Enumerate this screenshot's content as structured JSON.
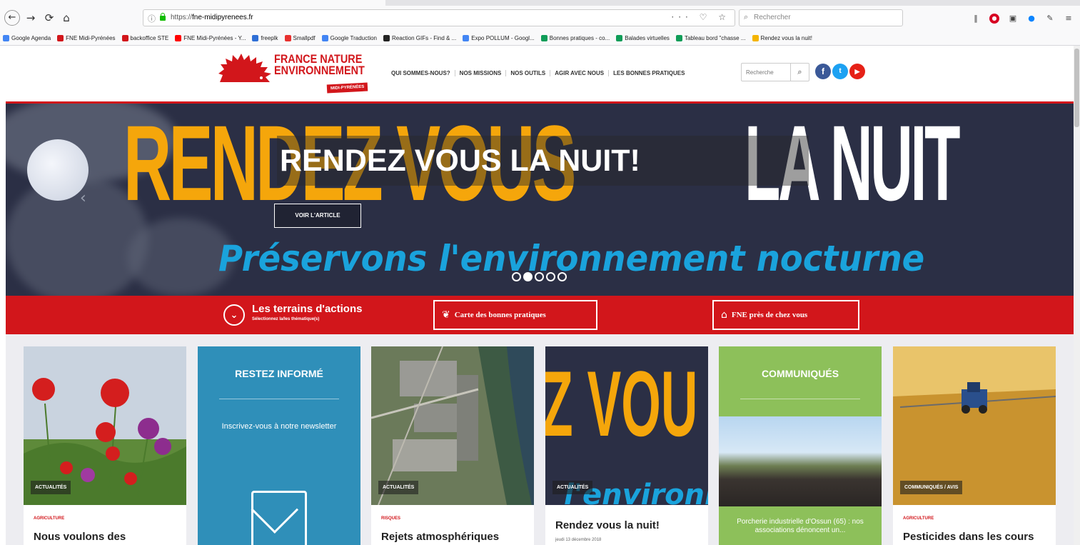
{
  "browser": {
    "back_glyph": "←",
    "forward_glyph": "→",
    "reload_glyph": "⟳",
    "home_glyph": "⌂",
    "url_prefix": "https://",
    "url_host": "fne-midipyrenees.fr",
    "url_actions": "··· ♡ ☆",
    "search_placeholder": "Rechercher",
    "bookmarks": [
      {
        "label": "Google Agenda",
        "color": "#4285f4"
      },
      {
        "label": "FNE Midi-Pyrénées",
        "color": "#d2161b"
      },
      {
        "label": "backoffice STE",
        "color": "#d2161b"
      },
      {
        "label": "FNE Midi-Pyrénées - Y...",
        "color": "#ff0000"
      },
      {
        "label": "freeplk",
        "color": "#2f6fd6"
      },
      {
        "label": "Smallpdf",
        "color": "#e8312f"
      },
      {
        "label": "Google Traduction",
        "color": "#4285f4"
      },
      {
        "label": "Reaction GIFs - Find & ...",
        "color": "#222222"
      },
      {
        "label": "Expo POLLUM - Googl...",
        "color": "#4285f4"
      },
      {
        "label": "Bonnes pratiques - co...",
        "color": "#0f9d58"
      },
      {
        "label": "Balades virtuelles",
        "color": "#0f9d58"
      },
      {
        "label": "Tableau bord \"chasse ...",
        "color": "#0f9d58"
      },
      {
        "label": "Rendez vous la nuit!",
        "color": "#f4b400"
      }
    ]
  },
  "site": {
    "logo_line1": "FRANCE NATURE",
    "logo_line2": "ENVIRONNEMENT",
    "logo_badge": "MIDI-PYRÉNÉES",
    "nav": [
      "QUI SOMMES-NOUS?",
      "NOS MISSIONS",
      "NOS OUTILS",
      "AGIR AVEC NOUS",
      "LES BONNES PRATIQUES"
    ],
    "search_placeholder": "Recherche",
    "social": {
      "facebook": "f",
      "twitter": "t",
      "youtube": "▶"
    }
  },
  "hero": {
    "poster_word1": "RENDEZ VOUS",
    "poster_word2": "LA NUIT",
    "caption": "RENDEZ VOUS LA NUIT!",
    "button": "VOIR L'ARTICLE",
    "subtitle": "Préservons l'environnement nocturne",
    "slide_count": 5,
    "active_slide": 2
  },
  "actionbar": {
    "terrain_title": "Les terrains d'actions",
    "terrain_sub": "Sélectionnez la/les thématique(s)",
    "carte": "Carte des bonnes pratiques",
    "fne": "FNE près de chez vous"
  },
  "cards": {
    "c1": {
      "tag": "ACTUALITÉS",
      "category": "AGRICULTURE",
      "title": "Nous voulons des"
    },
    "c2": {
      "heading": "RESTEZ INFORMÉ",
      "text": "Inscrivez-vous à notre newsletter"
    },
    "c3": {
      "tag": "ACTUALITÉS",
      "category": "RISQUES",
      "title": "Rejets atmosphériques"
    },
    "c4": {
      "tag": "ACTUALITÉS",
      "poster_text": "Z VOU",
      "poster_sub": "l'environn",
      "title": "Rendez vous la nuit!",
      "date": "jeudi 13 décembre 2018"
    },
    "c5": {
      "heading": "COMMUNIQUÉS",
      "text": "Porcherie industrielle d'Ossun (65) : nos associations dénoncent un..."
    },
    "c6": {
      "tag": "COMMUNIQUÉS / AVIS",
      "category": "AGRICULTURE",
      "title": "Pesticides dans les cours"
    }
  }
}
